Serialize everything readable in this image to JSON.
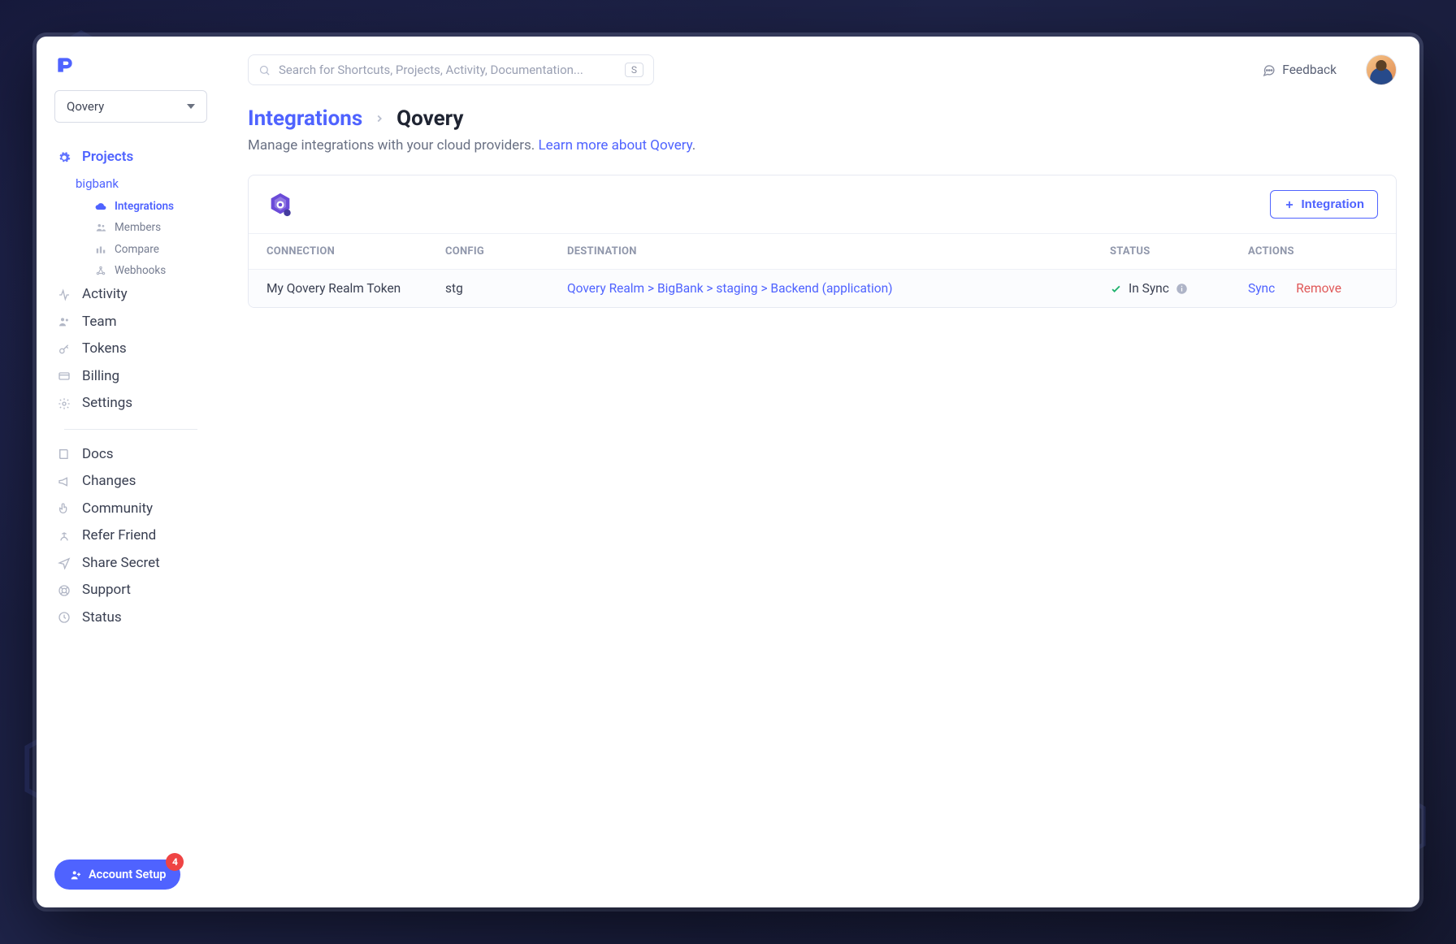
{
  "workspace": {
    "name": "Qovery"
  },
  "search": {
    "placeholder": "Search for Shortcuts, Projects, Activity, Documentation...",
    "kbd": "S"
  },
  "header": {
    "feedback": "Feedback"
  },
  "sidebar": {
    "projects_label": "Projects",
    "project_name": "bigbank",
    "project_children": [
      {
        "label": "Integrations"
      },
      {
        "label": "Members"
      },
      {
        "label": "Compare"
      },
      {
        "label": "Webhooks"
      }
    ],
    "items": [
      {
        "label": "Activity"
      },
      {
        "label": "Team"
      },
      {
        "label": "Tokens"
      },
      {
        "label": "Billing"
      },
      {
        "label": "Settings"
      }
    ],
    "secondary": [
      {
        "label": "Docs"
      },
      {
        "label": "Changes"
      },
      {
        "label": "Community"
      },
      {
        "label": "Refer Friend"
      },
      {
        "label": "Share Secret"
      },
      {
        "label": "Support"
      },
      {
        "label": "Status"
      }
    ]
  },
  "account_setup": {
    "label": "Account Setup",
    "badge": "4"
  },
  "breadcrumb": {
    "root": "Integrations",
    "leaf": "Qovery"
  },
  "subtitle": {
    "text": "Manage integrations with your cloud providers. ",
    "link": "Learn more about Qovery",
    "suffix": "."
  },
  "panel": {
    "add_button": "Integration",
    "columns": {
      "c0": "CONNECTION",
      "c1": "CONFIG",
      "c2": "DESTINATION",
      "c3": "STATUS",
      "c4": "ACTIONS"
    },
    "rows": [
      {
        "connection": "My Qovery Realm Token",
        "config": "stg",
        "destination": "Qovery Realm > BigBank > staging > Backend (application)",
        "status": "In Sync",
        "actions": {
          "sync": "Sync",
          "remove": "Remove"
        }
      }
    ]
  }
}
